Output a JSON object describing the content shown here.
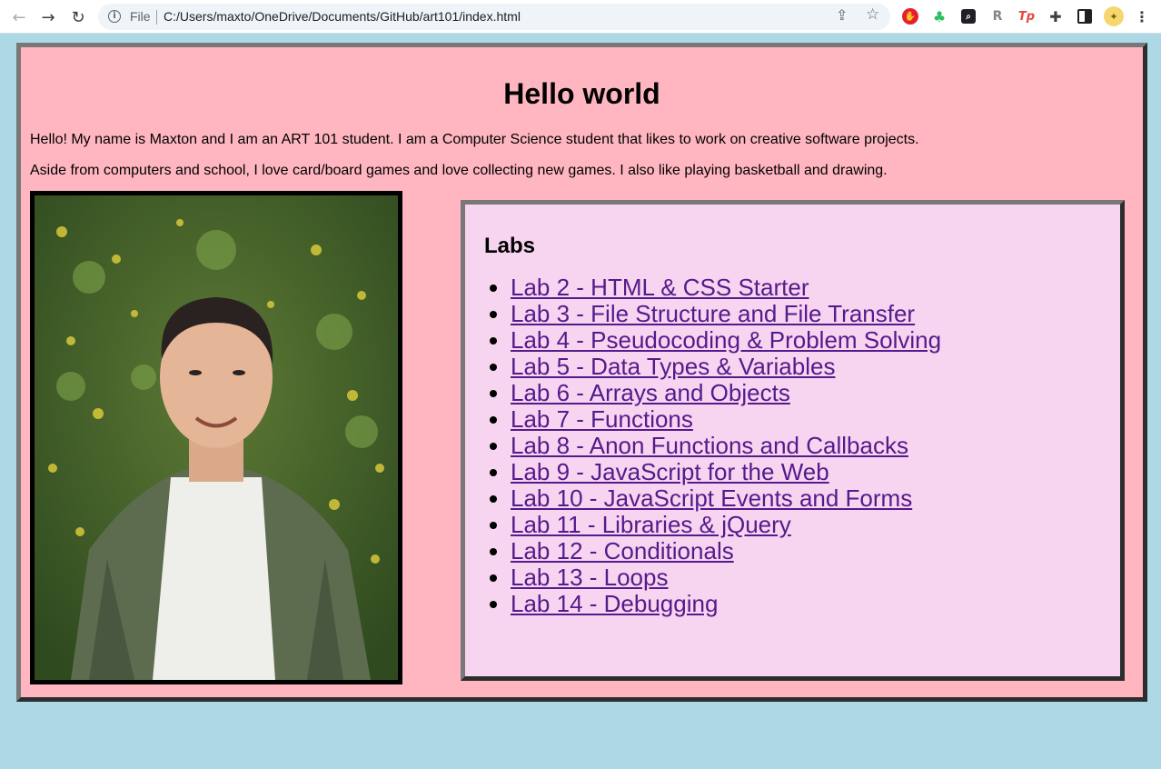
{
  "browser": {
    "back_icon": "arrow-left-icon",
    "forward_icon": "arrow-right-icon",
    "reload_icon": "reload-icon",
    "site_info_label": "File",
    "url": "C:/Users/maxto/OneDrive/Documents/GitHub/art101/index.html",
    "extensions": [
      "adblock-icon",
      "evernote-icon",
      "zoom-icon",
      "r-icon",
      "tp-icon",
      "puzzle-icon",
      "side-panel-icon",
      "profile-avatar",
      "menu-icon"
    ]
  },
  "page": {
    "title": "Hello world",
    "intro": "Hello! My name is Maxton and I am an ART 101 student. I am a Computer Science student that likes to work on creative software projects.",
    "about": "Aside from computers and school, I love card/board games and love collecting new games. I also like playing basketball and drawing.",
    "labs_heading": "Labs",
    "labs": [
      "Lab 2 - HTML & CSS Starter",
      "Lab 3 - File Structure and File Transfer",
      "Lab 4 - Pseudocoding & Problem Solving",
      "Lab 5 - Data Types & Variables",
      "Lab 6 - Arrays and Objects",
      "Lab 7 - Functions",
      "Lab 8 - Anon Functions and Callbacks",
      "Lab 9 - JavaScript for the Web",
      "Lab 10 - JavaScript Events and Forms",
      "Lab 11 - Libraries & jQuery",
      "Lab 12 - Conditionals",
      "Lab 13 - Loops",
      "Lab 14 - Debugging"
    ]
  },
  "colors": {
    "page_background": "#add8e6",
    "card_background": "#ffb6c1",
    "labs_background": "#f7d4f0",
    "link": "#551a8b"
  }
}
